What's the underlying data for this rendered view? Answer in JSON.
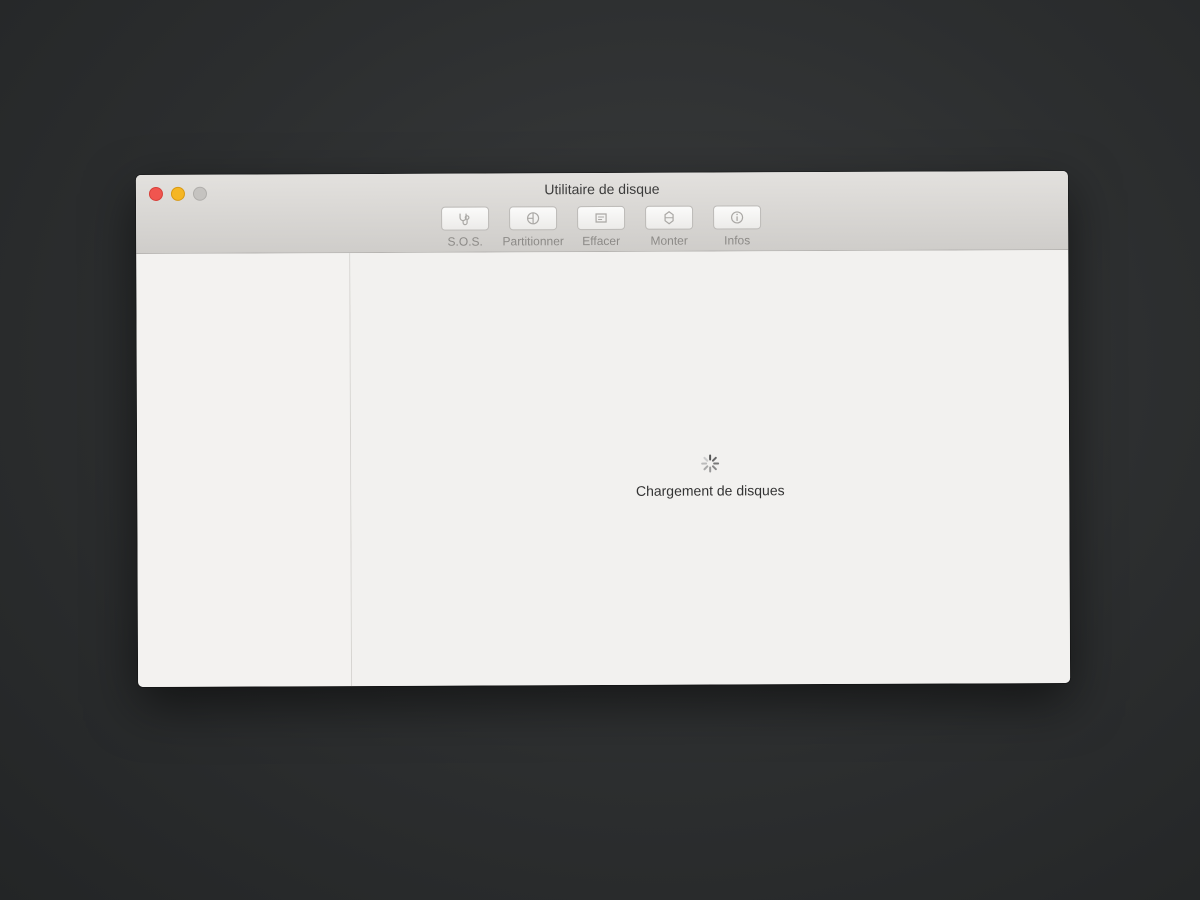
{
  "window": {
    "title": "Utilitaire de disque"
  },
  "toolbar": {
    "items": [
      {
        "label": "S.O.S.",
        "icon": "stethoscope-icon"
      },
      {
        "label": "Partitionner",
        "icon": "partition-icon"
      },
      {
        "label": "Effacer",
        "icon": "erase-icon"
      },
      {
        "label": "Monter",
        "icon": "mount-icon"
      },
      {
        "label": "Infos",
        "icon": "info-icon"
      }
    ]
  },
  "main": {
    "loading_text": "Chargement de disques"
  },
  "colors": {
    "close": "#f0554f",
    "minimize": "#f5b624",
    "zoom_disabled": "#c5c3c0"
  }
}
